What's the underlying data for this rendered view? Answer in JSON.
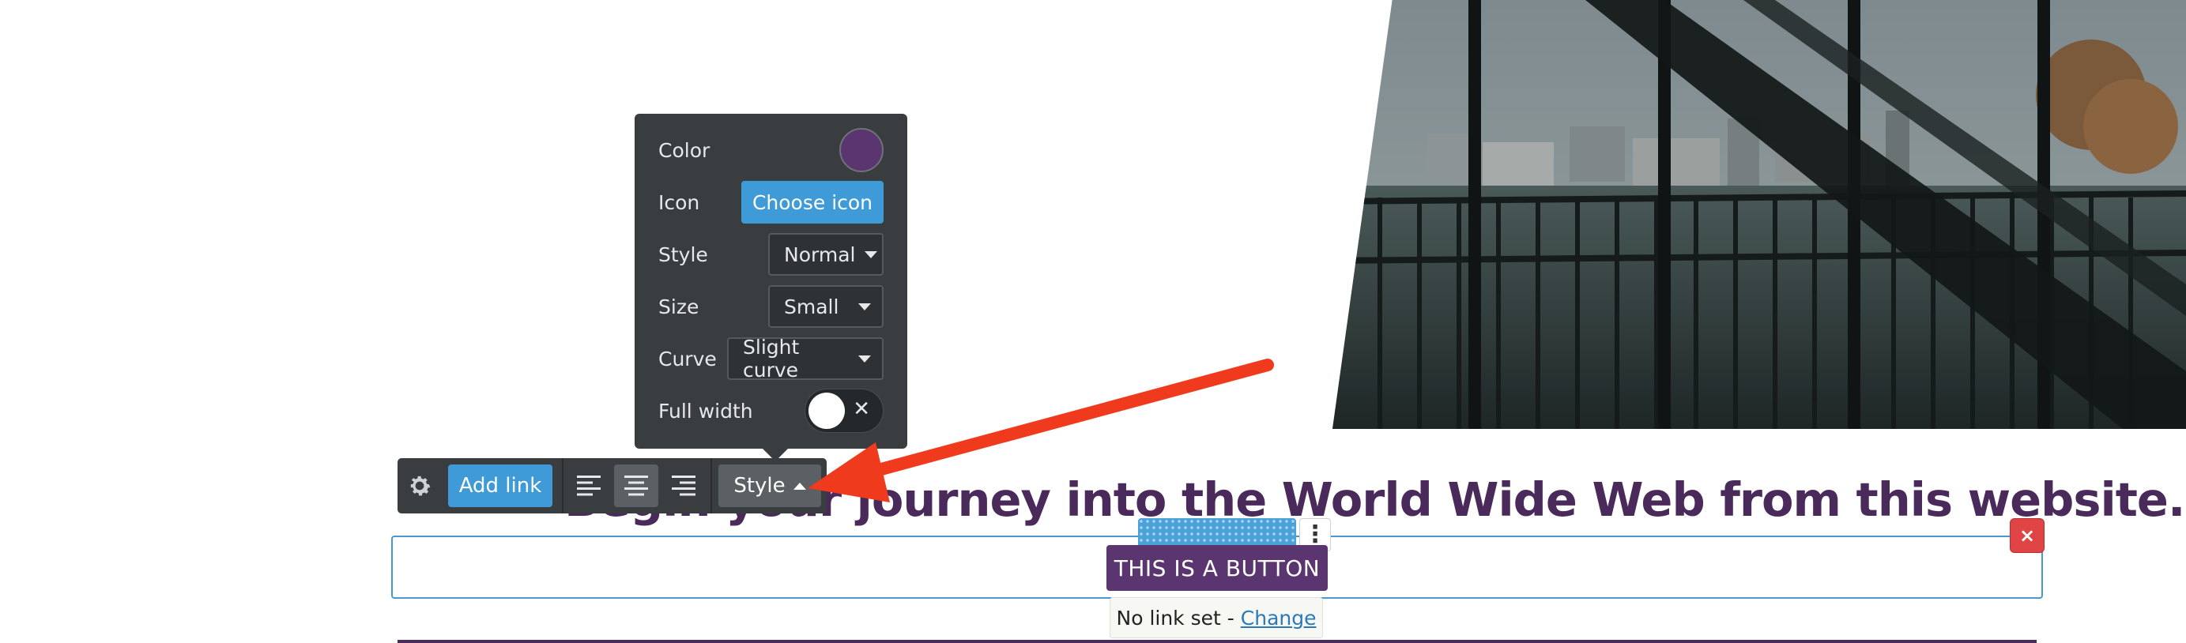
{
  "headline": "Begin your journey into the World Wide Web from this website.",
  "button": {
    "label": "THIS IS A BUTTON"
  },
  "link_tip": {
    "text": "No link set - ",
    "change_label": "Change"
  },
  "toolbar": {
    "gear_icon": "gear-icon",
    "add_link_label": "Add link",
    "style_label": "Style",
    "active_alignment": "center"
  },
  "popover": {
    "color_label": "Color",
    "color_value": "#5a3570",
    "icon_label": "Icon",
    "choose_icon_label": "Choose icon",
    "style_label": "Style",
    "style_value": "Normal",
    "size_label": "Size",
    "size_value": "Small",
    "curve_label": "Curve",
    "curve_value": "Slight curve",
    "full_width_label": "Full width",
    "full_width_on": false
  },
  "close_label": "×",
  "kebab_label": "⋮",
  "colors": {
    "brand": "#5a3570",
    "accent": "#3e9bd7",
    "danger": "#e04444",
    "annotation": "#f03a1e"
  }
}
